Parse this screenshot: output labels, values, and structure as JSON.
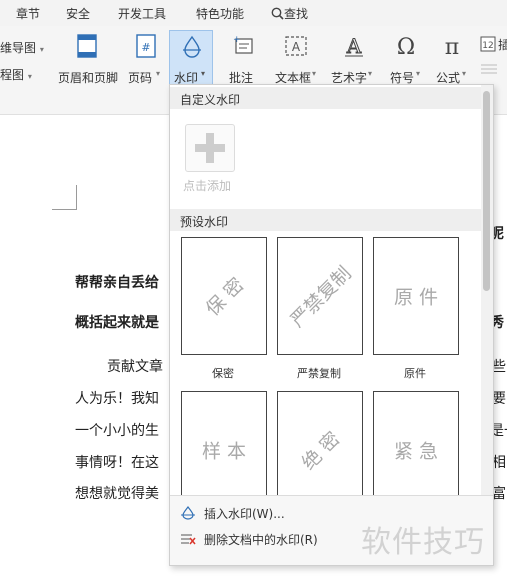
{
  "menubar": {
    "items": [
      "章节",
      "安全",
      "开发工具",
      "特色功能"
    ],
    "search_label": "查找"
  },
  "ribbon": {
    "left_partial_top": "维导图",
    "left_partial_bottom": "程图",
    "header_footer": "页眉和页脚",
    "page_number": "页码",
    "watermark": "水印",
    "annotation": "批注",
    "textbox": "文本框",
    "wordart": "艺术字",
    "symbol": "符号",
    "formula": "公式",
    "partial_right": "插"
  },
  "document": {
    "lines": [
      {
        "text": "帮帮亲自丢给",
        "bold": true
      },
      {
        "text": "概括起来就是",
        "bold": true
      },
      {
        "text": "贡献文章",
        "bold": false
      },
      {
        "text": "人为乐！我知",
        "bold": false
      },
      {
        "text": "一个小小的生",
        "bold": false
      },
      {
        "text": "事情呀！在这",
        "bold": false
      },
      {
        "text": "想想就觉得美",
        "bold": false
      }
    ],
    "right_fragments": [
      "呢",
      "秀",
      "些",
      "要",
      "是一",
      "相",
      "富"
    ]
  },
  "watermark_menu": {
    "custom_title": "自定义水印",
    "add_label": "点击添加",
    "preset_title": "预设水印",
    "presets": [
      {
        "text": "保 密",
        "label": "保密"
      },
      {
        "text": "严禁复制",
        "label": "严禁复制"
      },
      {
        "text": "原 件",
        "label": "原件"
      },
      {
        "text": "样 本",
        "label": ""
      },
      {
        "text": "绝 密",
        "label": ""
      },
      {
        "text": "紧 急",
        "label": ""
      }
    ],
    "insert_label": "插入水印(W)...",
    "delete_label": "删除文档中的水印(R)"
  },
  "brand_watermark": "软件技巧",
  "colors": {
    "ribbon_bg": "#f5f5f5",
    "menubar_bg": "#f3f3f3",
    "active_button_bg": "#cfe3f8",
    "icon_blue": "#2f6fb5",
    "preset_text": "#a9a9a9"
  }
}
